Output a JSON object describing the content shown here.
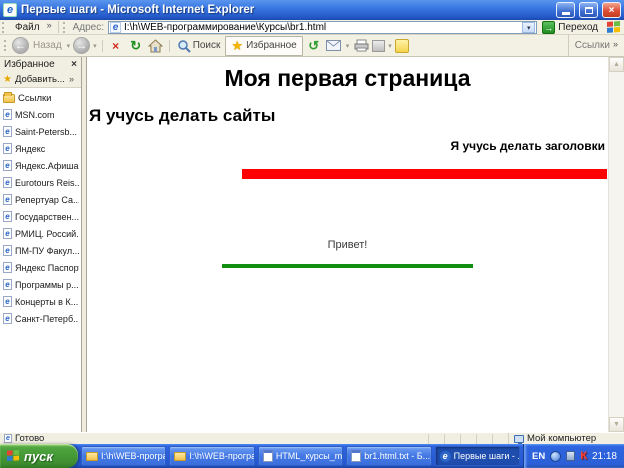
{
  "window": {
    "title": "Первые шаги - Microsoft Internet Explorer"
  },
  "menubar": {
    "file_menu": "Файл",
    "chevron": "»",
    "address_label": "Адрес:",
    "address_value": "I:\\h\\WEB-программирование\\Курсы\\br1.html",
    "go_button": "Переход"
  },
  "toolbar": {
    "back_label": "Назад",
    "search_label": "Поиск",
    "favorites_label": "Избранное",
    "links_label": "Ссылки",
    "chevron": "»"
  },
  "sidebar": {
    "title": "Избранное",
    "add_button": "Добавить...",
    "folder_label": "Ссылки",
    "items": [
      "MSN.com",
      "Saint-Petersb...",
      "Яндекс",
      "Яндекс.Афиша",
      "Eurotours Reis...",
      "Репертуар Са...",
      "Государствен...",
      "РМИЦ. Россий...",
      "ПМ-ПУ Факул...",
      "Яндекс Паспорт",
      "Программы р...",
      "Концерты в К...",
      "Санкт-Петерб..."
    ]
  },
  "page": {
    "h1": "Моя первая страница",
    "h2": "Я учусь делать сайты",
    "h4_right": "Я учусь делать заголовки",
    "greeting": "Привет!"
  },
  "statusbar": {
    "status": "Готово",
    "zone": "Мой компьютер"
  },
  "taskbar": {
    "start_label": "пуск",
    "buttons": [
      {
        "label": "I:\\h\\WEB-програ...",
        "icon": "folder"
      },
      {
        "label": "I:\\h\\WEB-програ...",
        "icon": "folder"
      },
      {
        "label": "HTML_курсы_my...",
        "icon": "notepad"
      },
      {
        "label": "br1.html.txt - Б...",
        "icon": "notepad"
      },
      {
        "label": "Первые шаги - ...",
        "icon": "ie",
        "active": true
      }
    ],
    "tray": {
      "language": "EN",
      "kaspersky": "К",
      "clock": "21:18"
    }
  },
  "icons": {
    "close_x": "×",
    "stop_x": "×",
    "refresh_glyph": "↻",
    "history_glyph": "↺",
    "star": "★",
    "caret_down": "▾",
    "arrow_left": "←",
    "arrow_right": "→",
    "up_arrow": "▲",
    "down_arrow": "▼",
    "ie_e": "e",
    "dropdown_v": "▾"
  },
  "colors": {
    "titlebar_blue": "#2E66D6",
    "toolbar_bg": "#F3F1E4",
    "taskbar_blue": "#2458D2",
    "start_green": "#3E8E30",
    "hr_red": "#FE0000",
    "hr_green": "#128E12",
    "address_border": "#7F9DB9",
    "active_task_blue": "#1E4DAE"
  }
}
